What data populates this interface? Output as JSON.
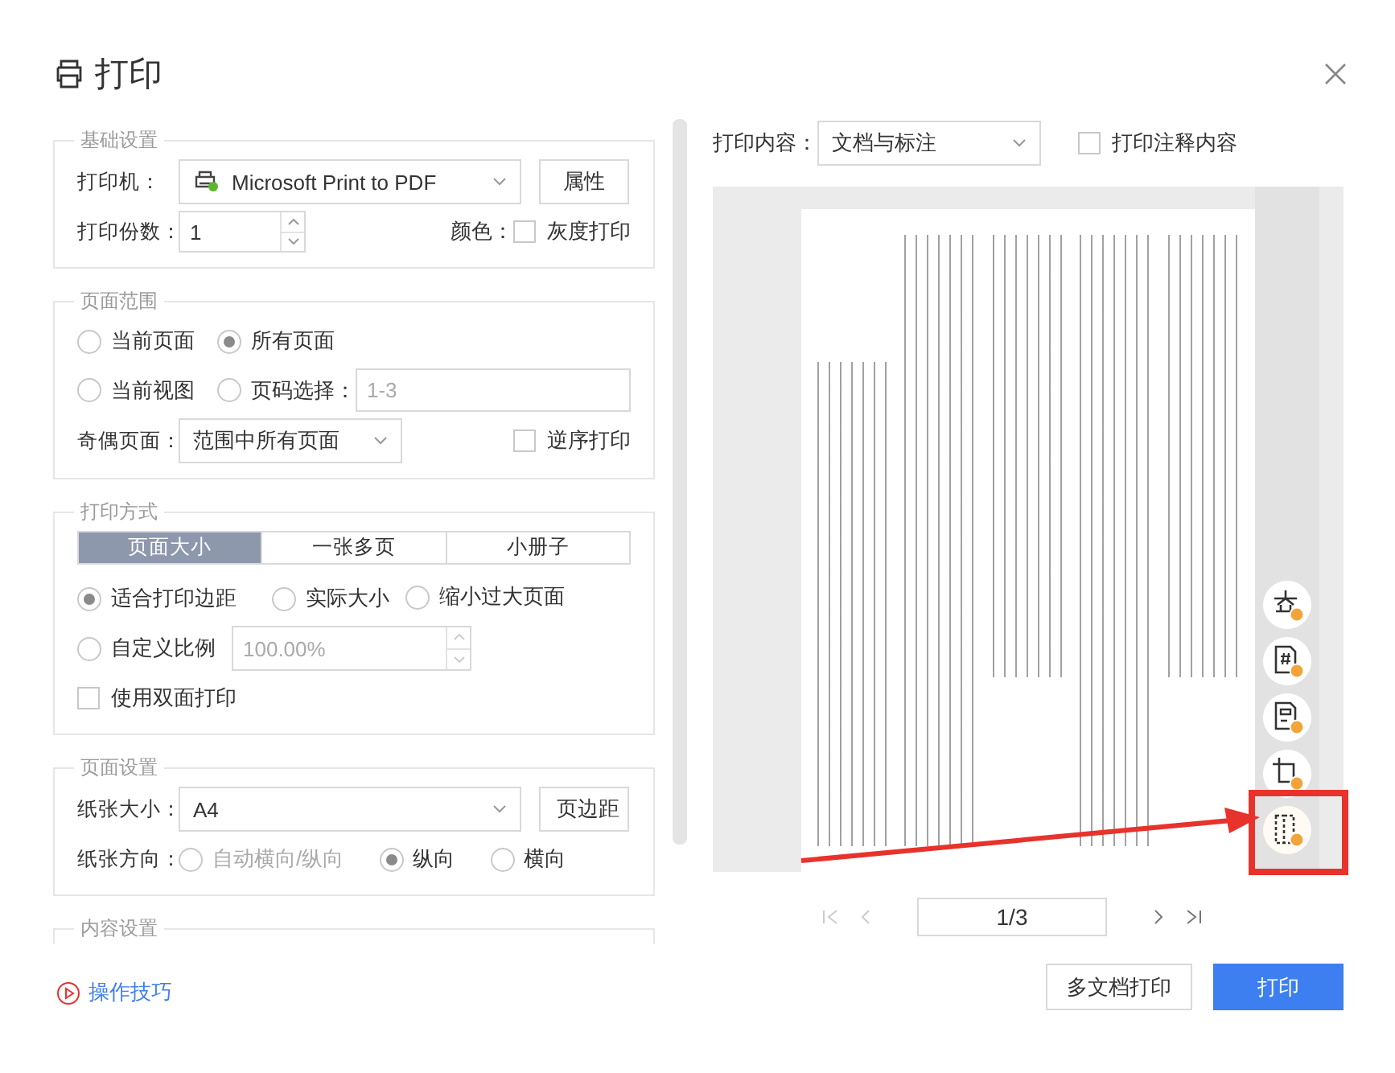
{
  "window": {
    "title": "打印"
  },
  "basic_settings": {
    "legend": "基础设置",
    "printer_label": "打印机：",
    "printer": "Microsoft Print to PDF",
    "properties_button": "属性",
    "copies_label": "打印份数：",
    "copies": "1",
    "color_label": "颜色：",
    "grayscale": {
      "label": "灰度打印",
      "checked": false
    }
  },
  "page_range": {
    "legend": "页面范围",
    "options": [
      {
        "label": "当前页面",
        "selected": false
      },
      {
        "label": "所有页面",
        "selected": true
      },
      {
        "label": "当前视图",
        "selected": false
      },
      {
        "label": "页码选择：",
        "selected": false
      }
    ],
    "pages_placeholder": "1-3",
    "odd_even_label": "奇偶页面：",
    "odd_even": "范围中所有页面",
    "reverse": {
      "label": "逆序打印",
      "checked": false
    }
  },
  "print_mode": {
    "legend": "打印方式",
    "tabs": [
      {
        "label": "页面大小",
        "selected": true
      },
      {
        "label": "一张多页",
        "selected": false
      },
      {
        "label": "小册子",
        "selected": false
      }
    ],
    "scale_options": [
      {
        "label": "适合打印边距",
        "selected": true
      },
      {
        "label": "实际大小",
        "selected": false
      },
      {
        "label": "缩小过大页面",
        "selected": false
      },
      {
        "label": "自定义比例",
        "selected": false
      }
    ],
    "custom_scale": "100.00%",
    "custom_scale_disabled": true,
    "duplex": {
      "label": "使用双面打印",
      "checked": false
    }
  },
  "page_setup": {
    "legend": "页面设置",
    "paper_size_label": "纸张大小：",
    "paper_size": "A4",
    "margins_button": "页边距",
    "orientation_label": "纸张方向：",
    "orientation_options": [
      {
        "label": "自动横向/纵向",
        "selected": false,
        "disabled": true
      },
      {
        "label": "纵向",
        "selected": true,
        "disabled": false
      },
      {
        "label": "横向",
        "selected": false,
        "disabled": false
      }
    ]
  },
  "content_settings": {
    "legend": "内容设置"
  },
  "tips_link": "操作技巧",
  "print_content": {
    "label": "打印内容：",
    "value": "文档与标注",
    "comments": {
      "label": "打印注释内容",
      "checked": false
    }
  },
  "side_tools": [
    {
      "kind": "watermark",
      "highlighted": false
    },
    {
      "kind": "page-number",
      "highlighted": false
    },
    {
      "kind": "header-footer",
      "highlighted": false
    },
    {
      "kind": "crop",
      "highlighted": false
    },
    {
      "kind": "select-area",
      "highlighted": true
    }
  ],
  "pager": {
    "page": "1/3",
    "first_disabled": true,
    "prev_disabled": true,
    "next_disabled": false,
    "last_disabled": false
  },
  "buttons": [
    {
      "label": "多文档打印",
      "kind": "secondary"
    },
    {
      "label": "打印",
      "kind": "primary"
    }
  ]
}
